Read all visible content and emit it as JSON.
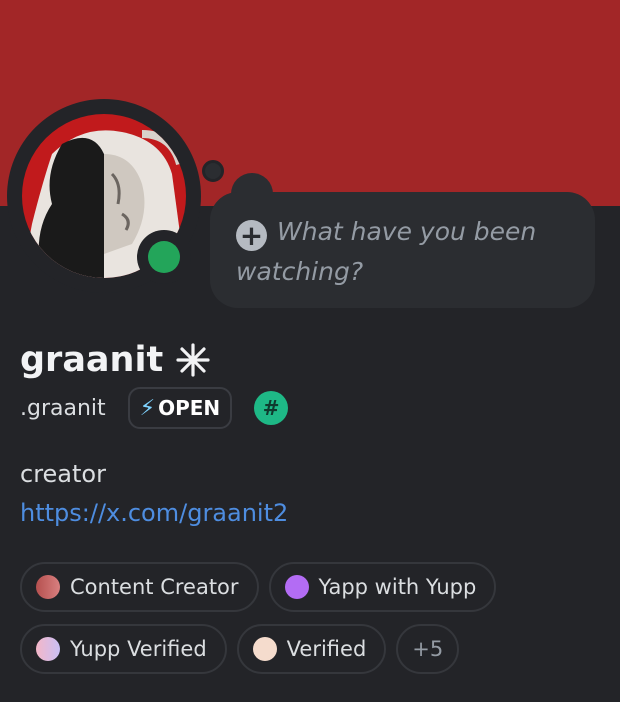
{
  "colors": {
    "banner": "#a22627",
    "background": "#232428",
    "status_online": "#23a55a",
    "link": "#4e8de0"
  },
  "activity": {
    "placeholder": "What have you been watching?"
  },
  "profile": {
    "display_name": "graanit",
    "username": ".graanit",
    "tag_label": "OPEN",
    "hash_badge": "#",
    "bio": "creator",
    "link": "https://x.com/graanit2"
  },
  "roles": [
    {
      "label": "Content Creator",
      "color": "#c0605e"
    },
    {
      "label": "Yapp with Yupp",
      "color": "#b36cf4"
    },
    {
      "label": "Yupp Verified",
      "color": "#e7b9d9"
    },
    {
      "label": "Verified",
      "color": "#f5dccd"
    }
  ],
  "roles_more": "+5",
  "icons": {
    "activity_add": "plus-circle-icon",
    "display_name_badge": "sparkle-icon",
    "tag_badge": "lightning-icon",
    "hash_badge": "hash-icon"
  }
}
